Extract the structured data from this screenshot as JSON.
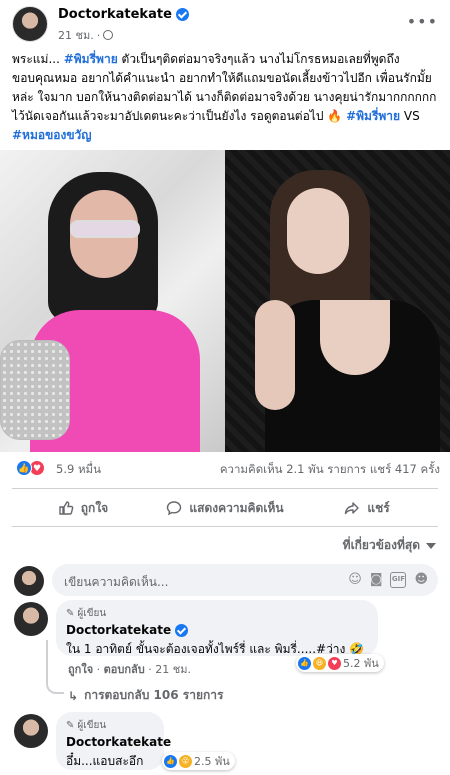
{
  "post": {
    "author": "Doctorkatekate",
    "time": "21 ชม.",
    "more_icon": "•••",
    "text_lines": [
      "พระแม่...",
      "#พิมรี่พาย",
      " ตัวเป็นๆติดต่อมาจริงๆแล้ว นางไม่โกรธหมอเลยที่พูดถึง ขอบคุณหมอ อยากได้คำแนะนำ อยากทำให้ดีแถมขอนัดเลี้ยงข้าวไปอีก เพื่อนรักมั้ยหล่ะ ใจมาก บอกให้นางติดต่อมาได้ นางก็ติดต่อมาจริงด้วย นางคุยน่ารักมากกกกกก ไว้นัดเจอกันแล้วจะมาอัปเดตนะคะว่าเป็นยังไง รอดูตอนต่อไป ",
      "🔥",
      "#พิมรี่พาย",
      " VS ",
      "#หมอของขวัญ"
    ]
  },
  "reactions": {
    "count": "5.9 หมื่น",
    "stats": "ความคิดเห็น 2.1 พัน รายการ  แชร์ 417 ครั้ง"
  },
  "actions": {
    "like": "ถูกใจ",
    "comment": "แสดงความคิดเห็น",
    "share": "แชร์"
  },
  "sort": "ที่เกี่ยวข้องที่สุด",
  "comment_box": {
    "placeholder": "เขียนความคิดเห็น...",
    "gif": "GIF"
  },
  "comments": [
    {
      "badge": "ผู้เขียน",
      "name": "Doctorkatekate",
      "text": "ใน 1 อาทิตย์ ขั้นจะต้องเจอทั้งไพร์รี่ และ พิมรี่.....#ว่าง 🤣",
      "reaction_count": "5.2 พัน",
      "like_label": "ถูกใจ",
      "reply_label": "ตอบกลับ",
      "time": "21 ชม.",
      "replies": "การตอบกลับ 106 รายการ"
    },
    {
      "badge": "ผู้เขียน",
      "name": "Doctorkatekate",
      "text": "อึ๋ม...แอบสะอึก",
      "reaction_count": "2.5 พัน"
    }
  ]
}
